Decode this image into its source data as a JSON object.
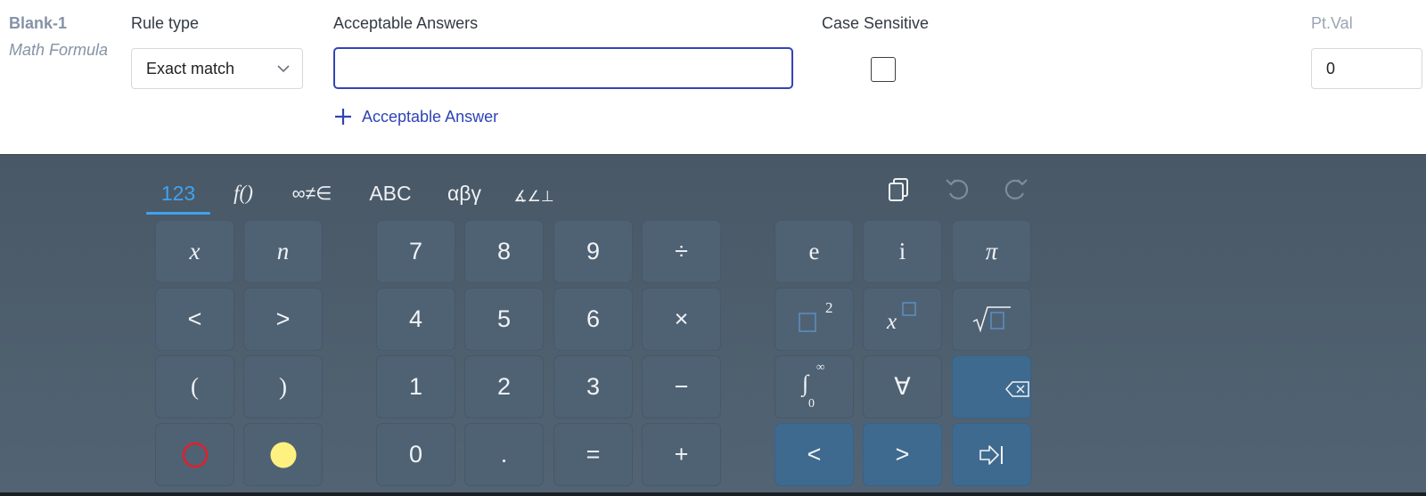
{
  "blank": {
    "title": "Blank-1",
    "subtitle": "Math Formula"
  },
  "headers": {
    "rule_type": "Rule type",
    "acceptable_answers": "Acceptable Answers",
    "case_sensitive": "Case Sensitive",
    "pt_val": "Pt.Val"
  },
  "rule_select": {
    "value": "Exact match",
    "icon": "chevron-down-icon"
  },
  "answer_input": {
    "value": "",
    "placeholder": ""
  },
  "add_answer": {
    "label": "Acceptable Answer",
    "icon": "plus-icon"
  },
  "case_sensitive_checked": false,
  "pt_val": {
    "value": "0"
  },
  "colors": {
    "accent": "#2e43b8",
    "keyboard_bg": "#4f6274",
    "active_tab": "#3fa2f0",
    "key_dark": "#3f6a90"
  },
  "keyboard": {
    "tabs": [
      {
        "label": "123",
        "active": true
      },
      {
        "label": "f()",
        "active": false
      },
      {
        "label": "∞≠∈",
        "active": false
      },
      {
        "label": "ABC",
        "active": false
      },
      {
        "label": "αβγ",
        "active": false
      },
      {
        "label": "∡∠⊥",
        "active": false
      }
    ],
    "tools": [
      "copy-icon",
      "undo-icon",
      "redo-icon"
    ],
    "keys": {
      "x": "x",
      "n": "n",
      "lt": "<",
      "gt": ">",
      "lparen": "(",
      "rparen": ")",
      "d7": "7",
      "d8": "8",
      "d9": "9",
      "div": "÷",
      "d4": "4",
      "d5": "5",
      "d6": "6",
      "mul": "×",
      "d1": "1",
      "d2": "2",
      "d3": "3",
      "minus": "−",
      "d0": "0",
      "dot": ".",
      "eq": "=",
      "plus": "+",
      "e": "e",
      "i": "i",
      "pi": "π",
      "forall": "∀",
      "square_exp": "2",
      "integral": "∫",
      "int_upper": "∞",
      "int_lower": "0",
      "left": "<",
      "right": ">"
    }
  }
}
